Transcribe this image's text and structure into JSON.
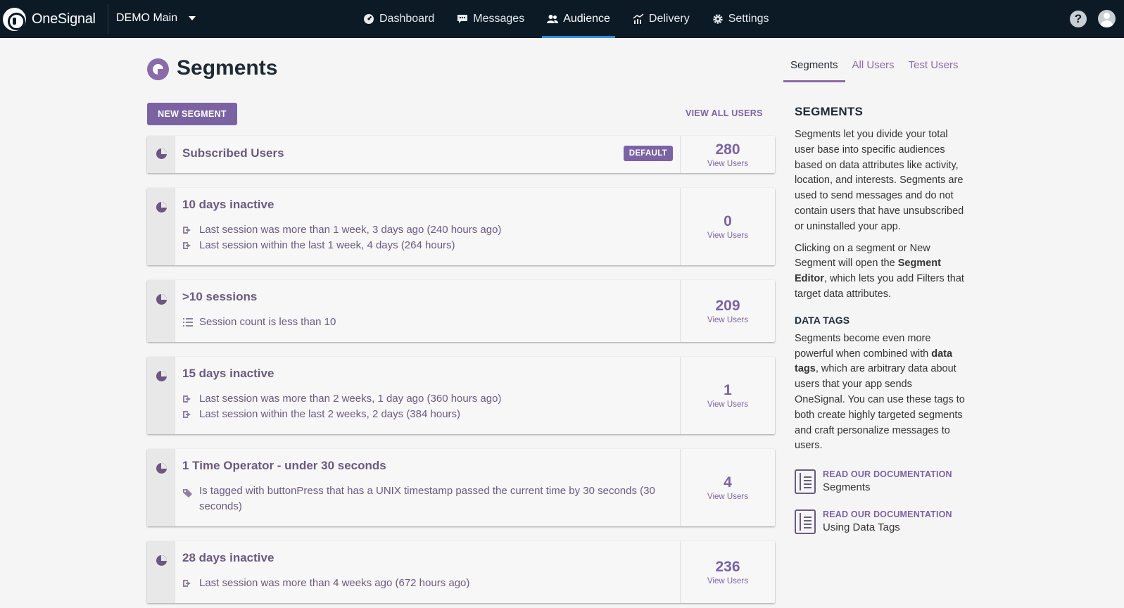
{
  "topbar": {
    "brand": "OneSignal",
    "app_name": "DEMO Main",
    "nav": [
      {
        "label": "Dashboard",
        "icon": "dashboard-icon",
        "active": false
      },
      {
        "label": "Messages",
        "icon": "messages-icon",
        "active": false
      },
      {
        "label": "Audience",
        "icon": "audience-icon",
        "active": true
      },
      {
        "label": "Delivery",
        "icon": "delivery-icon",
        "active": false
      },
      {
        "label": "Settings",
        "icon": "gear-icon",
        "active": false
      }
    ],
    "help": "?"
  },
  "page": {
    "title": "Segments",
    "new_segment_label": "NEW SEGMENT",
    "view_all_label": "VIEW ALL USERS"
  },
  "segments": [
    {
      "name": "Subscribed Users",
      "badge": "DEFAULT",
      "count": "280",
      "link": "View Users",
      "filters": []
    },
    {
      "name": "10 days inactive",
      "count": "0",
      "link": "View Users",
      "filters": [
        {
          "icon": "session-icon",
          "text": "Last session was more than 1 week, 3 days ago (240 hours ago)"
        },
        {
          "icon": "session-icon",
          "text": "Last session within the last 1 week, 4 days (264 hours)"
        }
      ]
    },
    {
      "name": ">10 sessions",
      "count": "209",
      "link": "View Users",
      "filters": [
        {
          "icon": "list-icon",
          "text": "Session count is less than 10"
        }
      ]
    },
    {
      "name": "15 days inactive",
      "count": "1",
      "link": "View Users",
      "filters": [
        {
          "icon": "session-icon",
          "text": "Last session was more than 2 weeks, 1 day ago (360 hours ago)"
        },
        {
          "icon": "session-icon",
          "text": "Last session within the last 2 weeks, 2 days (384 hours)"
        }
      ]
    },
    {
      "name": "1 Time Operator - under 30 seconds",
      "count": "4",
      "link": "View Users",
      "filters": [
        {
          "icon": "tag-icon",
          "text": "Is tagged with buttonPress that has a UNIX timestamp passed the current time by 30 seconds (30 seconds)"
        }
      ]
    },
    {
      "name": "28 days inactive",
      "count": "236",
      "link": "View Users",
      "filters": [
        {
          "icon": "session-icon",
          "text": "Last session was more than 4 weeks ago (672 hours ago)"
        }
      ]
    }
  ],
  "sidebar": {
    "tabs": [
      {
        "label": "Segments",
        "active": true
      },
      {
        "label": "All Users",
        "active": false
      },
      {
        "label": "Test Users",
        "active": false
      }
    ],
    "heading": "SEGMENTS",
    "para1": "Segments let you divide your total user base into specific audiences based on data attributes like activity, location, and interests. Segments are used to send messages and do not contain users that have unsubscribed or uninstalled your app.",
    "para2_a": "Clicking on a segment or New Segment will open the ",
    "para2_b": "Segment Editor",
    "para2_c": ", which lets you add Filters that target data attributes.",
    "data_tags_heading": "DATA TAGS",
    "para3_a": "Segments become even more powerful when combined with ",
    "para3_b": "data tags",
    "para3_c": ", which are arbitrary data about users that your app sends OneSignal. You can use these tags to both create highly targeted segments and craft personalize messages to users.",
    "docs": [
      {
        "kicker": "READ OUR DOCUMENTATION",
        "title": "Segments"
      },
      {
        "kicker": "READ OUR DOCUMENTATION",
        "title": "Using Data Tags"
      }
    ]
  },
  "colors": {
    "accent": "#7b63a3",
    "nav_bg": "#0c1a26",
    "nav_active": "#2f8fe0"
  }
}
